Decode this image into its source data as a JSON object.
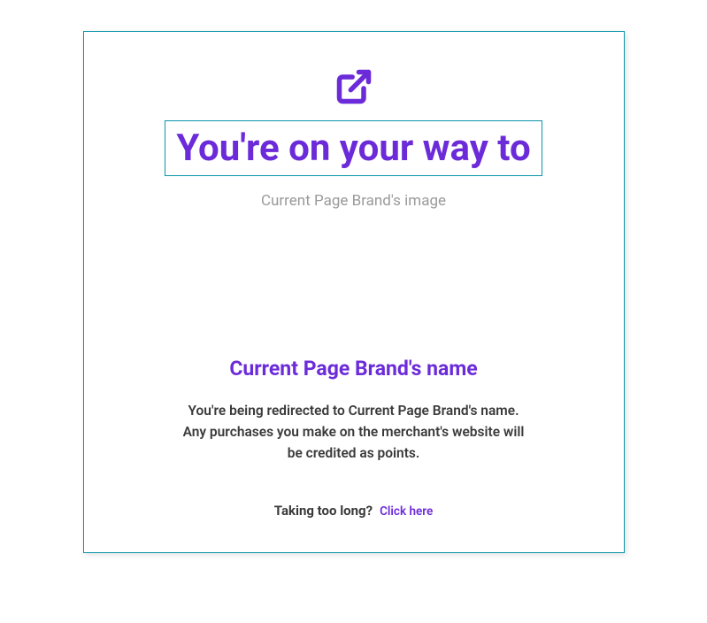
{
  "headline": "You're on your way to",
  "brand_image_alt": "Current Page Brand's image",
  "brand_name": "Current Page Brand's name",
  "redirect_text": "You're being redirected to Current Page Brand's name. Any purchases you make on the merchant's website will be credited as points.",
  "too_long_label": "Taking too long?",
  "click_here_label": "Click here",
  "colors": {
    "accent": "#6c2bd9",
    "border": "#0a95a8"
  }
}
